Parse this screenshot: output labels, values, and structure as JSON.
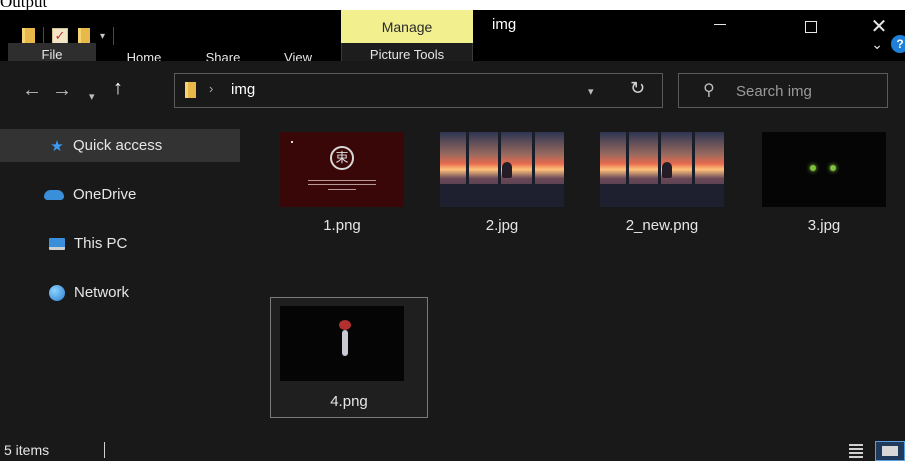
{
  "header_text": "Output",
  "window": {
    "title": "img",
    "contextual_tab": "Manage",
    "minimize_icon": "minimize-icon",
    "maximize_icon": "maximize-icon",
    "close_icon": "close-icon"
  },
  "ribbon": {
    "tabs": [
      "File",
      "Home",
      "Share",
      "View",
      "Picture Tools"
    ]
  },
  "navigation": {
    "back_icon": "←",
    "forward_icon": "→",
    "recent_icon": "⌄",
    "up_icon": "↑"
  },
  "address": {
    "separator": "›",
    "crumb": "img",
    "refresh_icon": "↻"
  },
  "search": {
    "placeholder": "Search img"
  },
  "sidebar": {
    "items": [
      {
        "label": "Quick access",
        "icon": "star-icon"
      },
      {
        "label": "OneDrive",
        "icon": "cloud-icon"
      },
      {
        "label": "This PC",
        "icon": "computer-icon"
      },
      {
        "label": "Network",
        "icon": "network-icon"
      }
    ]
  },
  "files": [
    {
      "name": "1.png"
    },
    {
      "name": "2.jpg"
    },
    {
      "name": "2_new.png"
    },
    {
      "name": "3.jpg"
    },
    {
      "name": "4.png"
    }
  ],
  "status": {
    "count": "5 items"
  },
  "colors": {
    "background": "#191919",
    "titlebar": "#000000",
    "manage_tab": "#f2ef8f",
    "accent": "#3a9bf5"
  }
}
